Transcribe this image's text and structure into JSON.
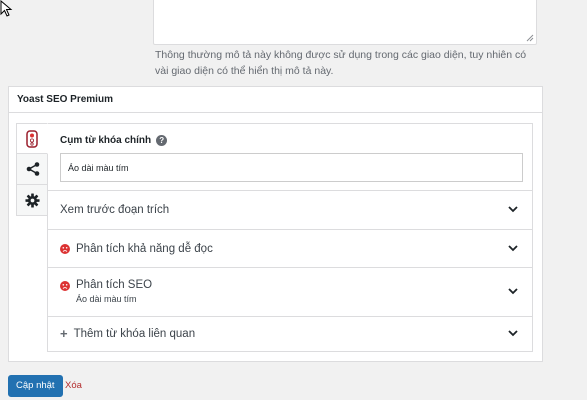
{
  "description": {
    "help_text": "Thông thường mô tả này không được sử dụng trong các giao diện, tuy nhiên có vài giao diện có thể hiển thị mô tả này."
  },
  "metabox": {
    "title": "Yoast SEO Premium",
    "tabs": [
      {
        "icon": "traffic-light-icon",
        "active": true
      },
      {
        "icon": "share-icon",
        "active": false
      },
      {
        "icon": "gear-icon",
        "active": false
      }
    ],
    "focus_keyphrase": {
      "label": "Cụm từ khóa chính",
      "help": "?",
      "value": "Áo dài màu tím"
    },
    "sections": {
      "snippet": {
        "title": "Xem trước đoạn trích"
      },
      "readability": {
        "title": "Phân tích khả năng dễ đọc",
        "status_color": "#dc3232"
      },
      "seo": {
        "title": "Phân tích SEO",
        "subtitle": "Áo dài màu tím",
        "status_color": "#dc3232"
      },
      "related": {
        "title": "Thêm từ khóa liên quan",
        "icon": "+"
      }
    }
  },
  "actions": {
    "update_label": "Cập nhật",
    "delete_label": "Xóa"
  },
  "colors": {
    "primary": "#2271b1",
    "danger": "#b32d2e",
    "status_bad": "#dc3232"
  }
}
